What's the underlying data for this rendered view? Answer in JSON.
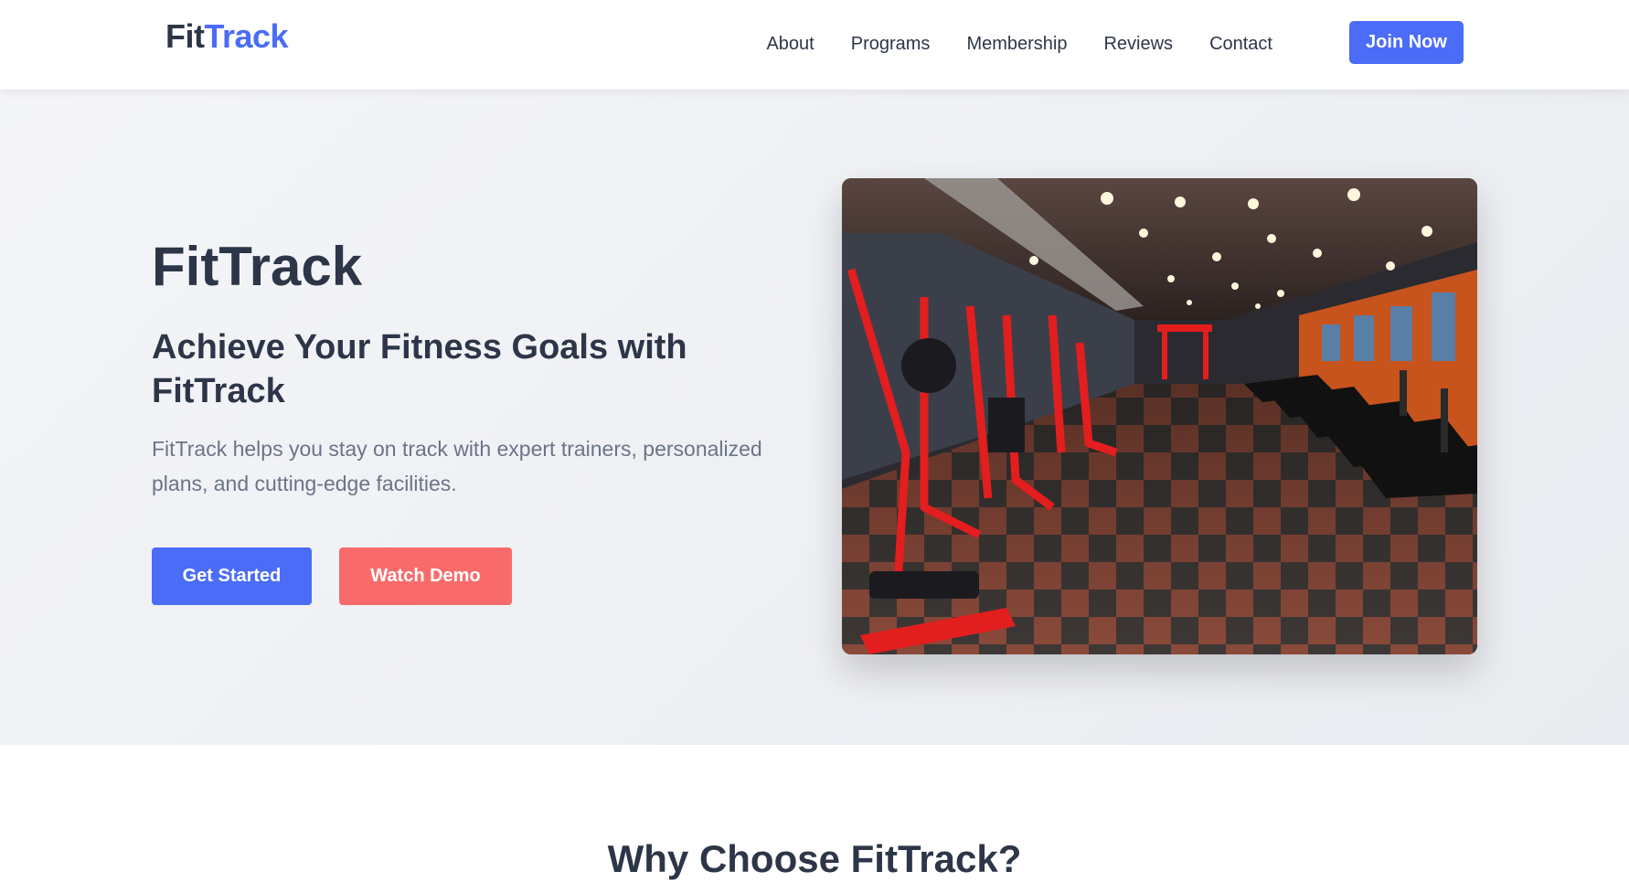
{
  "brand": {
    "part_a": "Fit",
    "part_b": "Track",
    "accent_color": "#4a6cf7",
    "text_color": "#2d3648"
  },
  "nav": {
    "links": [
      "About",
      "Programs",
      "Membership",
      "Reviews",
      "Contact"
    ],
    "cta_label": "Join Now"
  },
  "hero": {
    "title": "FitTrack",
    "subtitle": "Achieve Your Fitness Goals with FitTrack",
    "description": "FitTrack helps you stay on track with expert trainers, personalized plans, and cutting-edge facilities.",
    "primary_button": "Get Started",
    "secondary_button": "Watch Demo",
    "primary_color": "#4a6cf7",
    "secondary_color": "#f96b6b",
    "image_subject": "gym-interior-photo"
  },
  "features": {
    "heading": "Why Choose FitTrack?"
  }
}
